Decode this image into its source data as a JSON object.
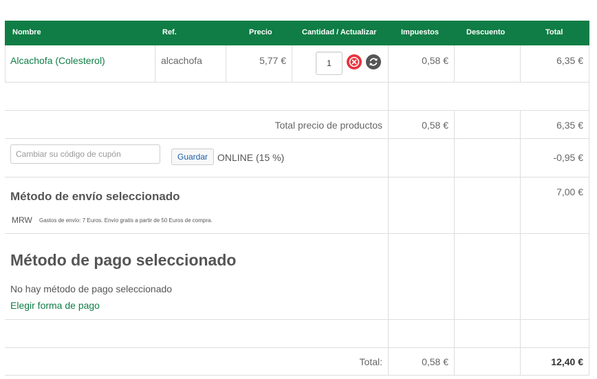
{
  "table": {
    "headers": {
      "nombre": "Nombre",
      "ref": "Ref.",
      "precio": "Precio",
      "cantidad": "Cantidad / Actualizar",
      "impuestos": "Impuestos",
      "descuento": "Descuento",
      "total": "Total"
    },
    "product": {
      "name": "Alcachofa (Colesterol)",
      "ref": "alcachofa",
      "price": "5,77 €",
      "quantity": "1",
      "tax": "0,58 €",
      "total": "6,35 €"
    }
  },
  "subtotal": {
    "label": "Total precio de productos",
    "tax": "0,58 €",
    "total": "6,35 €"
  },
  "coupon": {
    "placeholder": "Cambiar su código de cupón",
    "button_label": "Guardar",
    "applied": "ONLINE (15 %)",
    "discount": "-0,95 €"
  },
  "shipping": {
    "heading": "Método de envío seleccionado",
    "carrier": "MRW",
    "note": "Gastos de envío: 7 Euros. Envío gratis a partir de 50 Euros de compra.",
    "cost": "7,00 €"
  },
  "payment": {
    "heading": "Método de pago seleccionado",
    "none_text": "No hay método de pago seleccionado",
    "choose_link": "Elegir forma de pago"
  },
  "grand_total": {
    "label": "Total:",
    "tax": "0,58 €",
    "total": "12,40 €"
  },
  "colors": {
    "header_bg": "#0f7d45",
    "link": "#0f7d45",
    "remove_button": "#e8323c",
    "refresh_button": "#555555"
  },
  "icons": {
    "remove": "close-circle-icon",
    "refresh": "refresh-icon"
  }
}
